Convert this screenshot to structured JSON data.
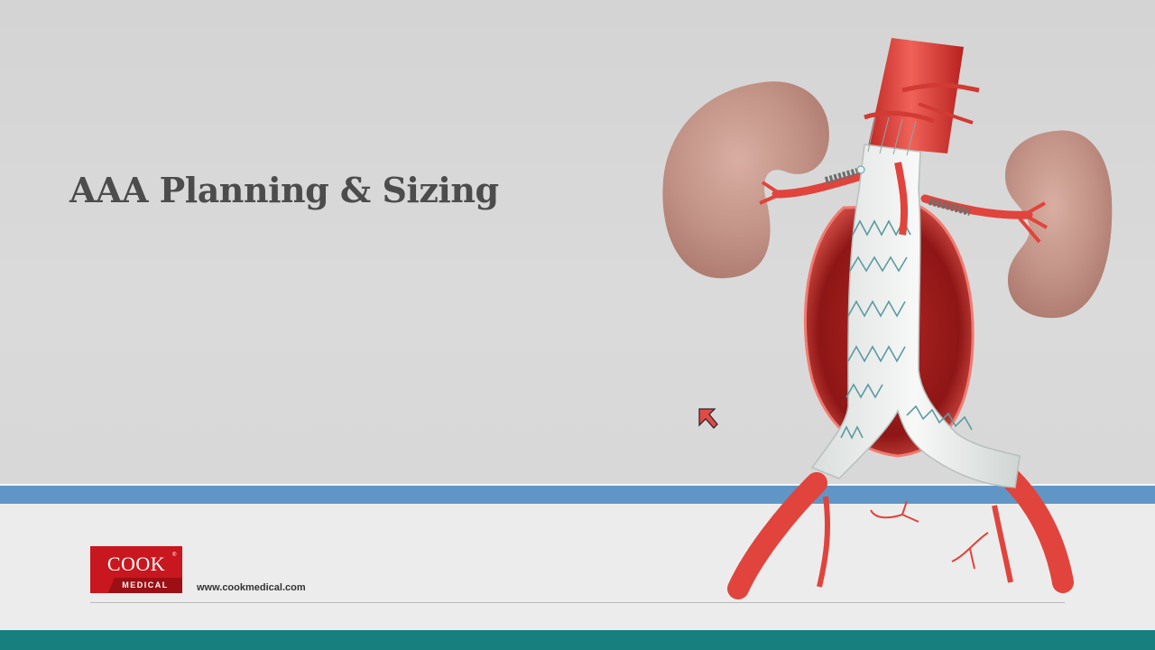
{
  "slide": {
    "title": "AAA Planning & Sizing",
    "website": "www.cookmedical.com"
  },
  "logo": {
    "word": "COOK",
    "registered": "®",
    "subword": "MEDICAL",
    "color": "#c8171e"
  },
  "colors": {
    "background": "#d8d8d8",
    "blue_band": "#6096c6",
    "teal_band": "#17807f",
    "footer": "#ececec",
    "artery_red": "#e0443c",
    "graft_white": "#f1f3f1"
  },
  "illustration": {
    "icon": "aortic-stent-graft-illustration"
  },
  "cursor": {
    "icon": "red-arrow-cursor-icon"
  }
}
